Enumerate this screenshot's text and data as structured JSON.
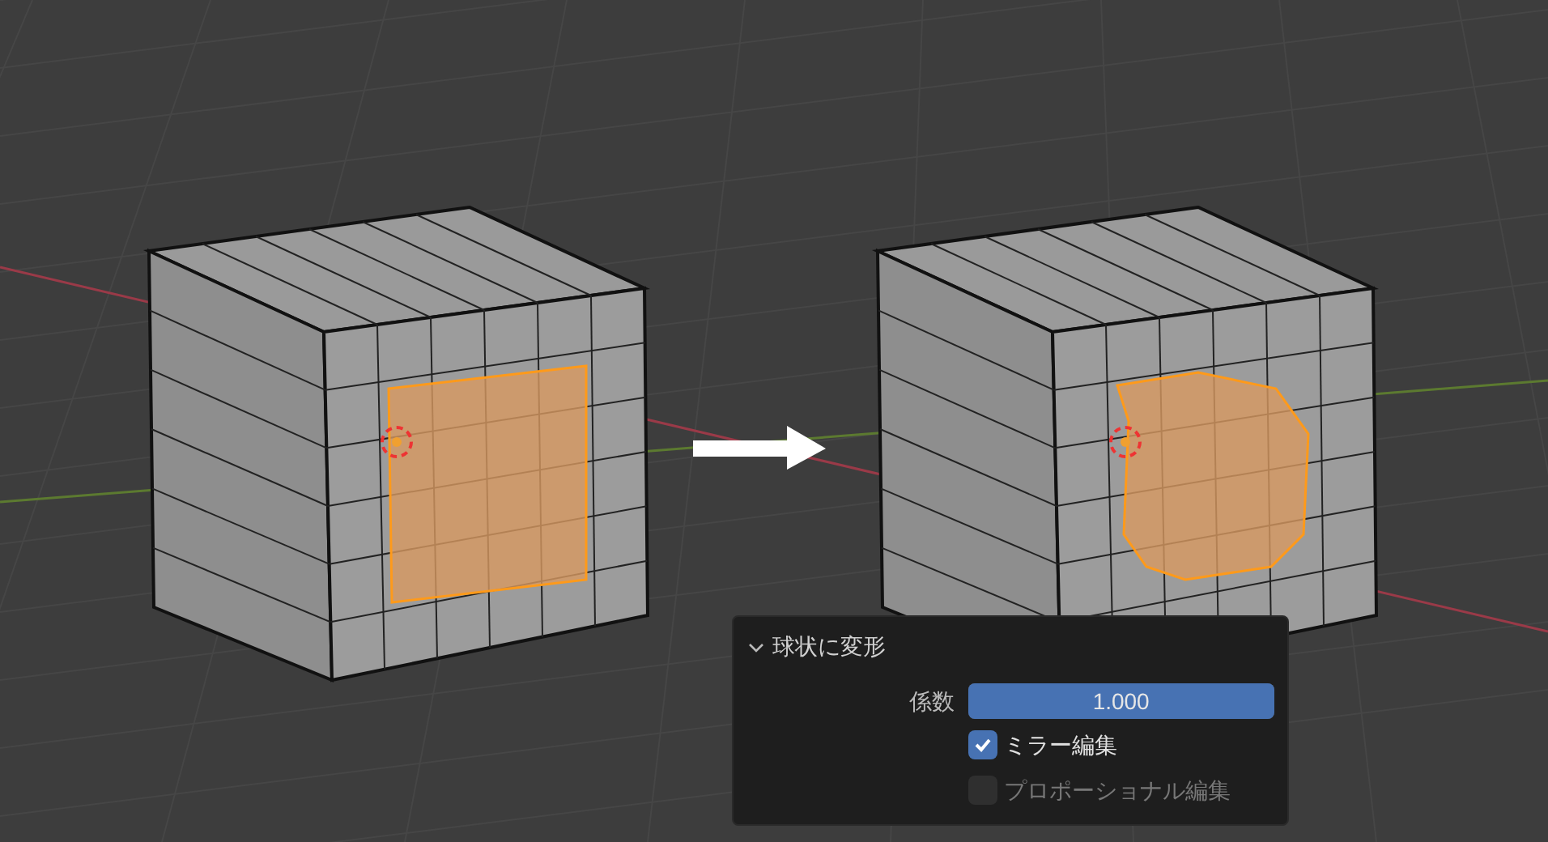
{
  "operator_panel": {
    "title": "球状に変形",
    "expanded": true,
    "factor": {
      "label": "係数",
      "value": "1.000",
      "level": 1
    },
    "options": [
      {
        "label": "ミラー編集",
        "checked": true,
        "disabled": false
      },
      {
        "label": "プロポーショナル編集",
        "checked": false,
        "disabled": true
      }
    ]
  }
}
